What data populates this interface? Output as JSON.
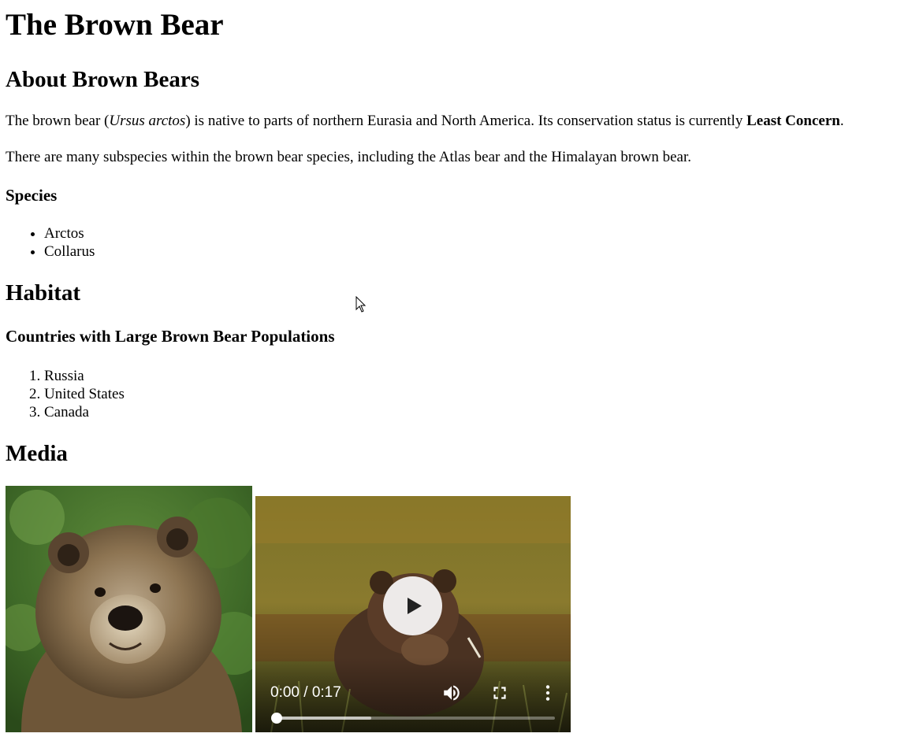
{
  "page": {
    "title": "The Brown Bear",
    "about_heading": "About Brown Bears",
    "intro": {
      "before": "The brown bear (",
      "latin": "Ursus arctos",
      "middle": ") is native to parts of northern Eurasia and North America. Its conservation status is currently ",
      "status": "Least Concern",
      "after": "."
    },
    "subspecies_text": "There are many subspecies within the brown bear species, including the Atlas bear and the Himalayan brown bear.",
    "species_heading": "Species",
    "species": [
      "Arctos",
      "Collarus"
    ],
    "habitat_heading": "Habitat",
    "countries_heading": "Countries with Large Brown Bear Populations",
    "countries": [
      "Russia",
      "United States",
      "Canada"
    ],
    "media_heading": "Media"
  },
  "media": {
    "image_icon": "grizzly-bear-photo",
    "video": {
      "time_display": "0:00 / 0:17",
      "progress": 0,
      "buffered": 0.34,
      "play_icon": "play-icon",
      "mute_icon": "volume-icon",
      "fullscreen_icon": "fullscreen-icon",
      "more_icon": "more-vertical-icon"
    }
  },
  "colors": {
    "text": "#000000",
    "background": "#ffffff",
    "video_controls": "#ffffff"
  }
}
